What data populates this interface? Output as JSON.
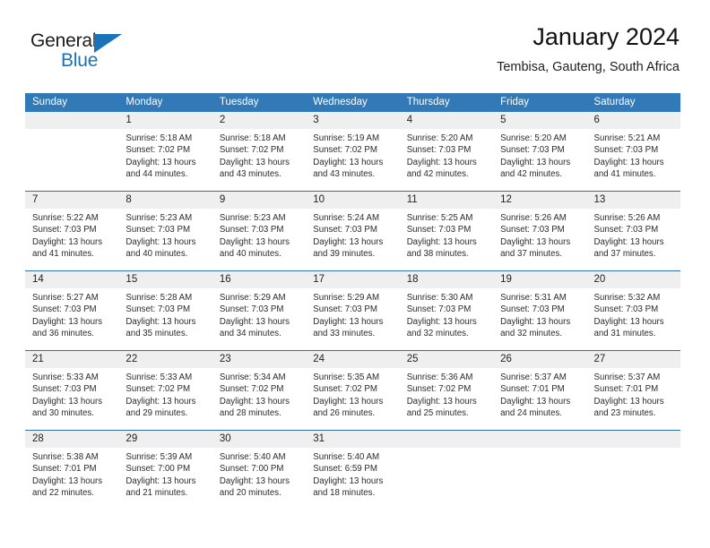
{
  "brand": {
    "word1": "General",
    "word2": "Blue",
    "logo_icon": "triangle-flag-icon",
    "accent_color": "#1a72b8"
  },
  "header": {
    "title": "January 2024",
    "location": "Tembisa, Gauteng, South Africa"
  },
  "calendar": {
    "header_bg": "#3279b7",
    "daynum_bg": "#efefef",
    "weekdays": [
      "Sunday",
      "Monday",
      "Tuesday",
      "Wednesday",
      "Thursday",
      "Friday",
      "Saturday"
    ],
    "weeks": [
      [
        {
          "day": "",
          "sunrise": "",
          "sunset": "",
          "daylight1": "",
          "daylight2": ""
        },
        {
          "day": "1",
          "sunrise": "Sunrise: 5:18 AM",
          "sunset": "Sunset: 7:02 PM",
          "daylight1": "Daylight: 13 hours",
          "daylight2": "and 44 minutes."
        },
        {
          "day": "2",
          "sunrise": "Sunrise: 5:18 AM",
          "sunset": "Sunset: 7:02 PM",
          "daylight1": "Daylight: 13 hours",
          "daylight2": "and 43 minutes."
        },
        {
          "day": "3",
          "sunrise": "Sunrise: 5:19 AM",
          "sunset": "Sunset: 7:02 PM",
          "daylight1": "Daylight: 13 hours",
          "daylight2": "and 43 minutes."
        },
        {
          "day": "4",
          "sunrise": "Sunrise: 5:20 AM",
          "sunset": "Sunset: 7:03 PM",
          "daylight1": "Daylight: 13 hours",
          "daylight2": "and 42 minutes."
        },
        {
          "day": "5",
          "sunrise": "Sunrise: 5:20 AM",
          "sunset": "Sunset: 7:03 PM",
          "daylight1": "Daylight: 13 hours",
          "daylight2": "and 42 minutes."
        },
        {
          "day": "6",
          "sunrise": "Sunrise: 5:21 AM",
          "sunset": "Sunset: 7:03 PM",
          "daylight1": "Daylight: 13 hours",
          "daylight2": "and 41 minutes."
        }
      ],
      [
        {
          "day": "7",
          "sunrise": "Sunrise: 5:22 AM",
          "sunset": "Sunset: 7:03 PM",
          "daylight1": "Daylight: 13 hours",
          "daylight2": "and 41 minutes."
        },
        {
          "day": "8",
          "sunrise": "Sunrise: 5:23 AM",
          "sunset": "Sunset: 7:03 PM",
          "daylight1": "Daylight: 13 hours",
          "daylight2": "and 40 minutes."
        },
        {
          "day": "9",
          "sunrise": "Sunrise: 5:23 AM",
          "sunset": "Sunset: 7:03 PM",
          "daylight1": "Daylight: 13 hours",
          "daylight2": "and 40 minutes."
        },
        {
          "day": "10",
          "sunrise": "Sunrise: 5:24 AM",
          "sunset": "Sunset: 7:03 PM",
          "daylight1": "Daylight: 13 hours",
          "daylight2": "and 39 minutes."
        },
        {
          "day": "11",
          "sunrise": "Sunrise: 5:25 AM",
          "sunset": "Sunset: 7:03 PM",
          "daylight1": "Daylight: 13 hours",
          "daylight2": "and 38 minutes."
        },
        {
          "day": "12",
          "sunrise": "Sunrise: 5:26 AM",
          "sunset": "Sunset: 7:03 PM",
          "daylight1": "Daylight: 13 hours",
          "daylight2": "and 37 minutes."
        },
        {
          "day": "13",
          "sunrise": "Sunrise: 5:26 AM",
          "sunset": "Sunset: 7:03 PM",
          "daylight1": "Daylight: 13 hours",
          "daylight2": "and 37 minutes."
        }
      ],
      [
        {
          "day": "14",
          "sunrise": "Sunrise: 5:27 AM",
          "sunset": "Sunset: 7:03 PM",
          "daylight1": "Daylight: 13 hours",
          "daylight2": "and 36 minutes."
        },
        {
          "day": "15",
          "sunrise": "Sunrise: 5:28 AM",
          "sunset": "Sunset: 7:03 PM",
          "daylight1": "Daylight: 13 hours",
          "daylight2": "and 35 minutes."
        },
        {
          "day": "16",
          "sunrise": "Sunrise: 5:29 AM",
          "sunset": "Sunset: 7:03 PM",
          "daylight1": "Daylight: 13 hours",
          "daylight2": "and 34 minutes."
        },
        {
          "day": "17",
          "sunrise": "Sunrise: 5:29 AM",
          "sunset": "Sunset: 7:03 PM",
          "daylight1": "Daylight: 13 hours",
          "daylight2": "and 33 minutes."
        },
        {
          "day": "18",
          "sunrise": "Sunrise: 5:30 AM",
          "sunset": "Sunset: 7:03 PM",
          "daylight1": "Daylight: 13 hours",
          "daylight2": "and 32 minutes."
        },
        {
          "day": "19",
          "sunrise": "Sunrise: 5:31 AM",
          "sunset": "Sunset: 7:03 PM",
          "daylight1": "Daylight: 13 hours",
          "daylight2": "and 32 minutes."
        },
        {
          "day": "20",
          "sunrise": "Sunrise: 5:32 AM",
          "sunset": "Sunset: 7:03 PM",
          "daylight1": "Daylight: 13 hours",
          "daylight2": "and 31 minutes."
        }
      ],
      [
        {
          "day": "21",
          "sunrise": "Sunrise: 5:33 AM",
          "sunset": "Sunset: 7:03 PM",
          "daylight1": "Daylight: 13 hours",
          "daylight2": "and 30 minutes."
        },
        {
          "day": "22",
          "sunrise": "Sunrise: 5:33 AM",
          "sunset": "Sunset: 7:02 PM",
          "daylight1": "Daylight: 13 hours",
          "daylight2": "and 29 minutes."
        },
        {
          "day": "23",
          "sunrise": "Sunrise: 5:34 AM",
          "sunset": "Sunset: 7:02 PM",
          "daylight1": "Daylight: 13 hours",
          "daylight2": "and 28 minutes."
        },
        {
          "day": "24",
          "sunrise": "Sunrise: 5:35 AM",
          "sunset": "Sunset: 7:02 PM",
          "daylight1": "Daylight: 13 hours",
          "daylight2": "and 26 minutes."
        },
        {
          "day": "25",
          "sunrise": "Sunrise: 5:36 AM",
          "sunset": "Sunset: 7:02 PM",
          "daylight1": "Daylight: 13 hours",
          "daylight2": "and 25 minutes."
        },
        {
          "day": "26",
          "sunrise": "Sunrise: 5:37 AM",
          "sunset": "Sunset: 7:01 PM",
          "daylight1": "Daylight: 13 hours",
          "daylight2": "and 24 minutes."
        },
        {
          "day": "27",
          "sunrise": "Sunrise: 5:37 AM",
          "sunset": "Sunset: 7:01 PM",
          "daylight1": "Daylight: 13 hours",
          "daylight2": "and 23 minutes."
        }
      ],
      [
        {
          "day": "28",
          "sunrise": "Sunrise: 5:38 AM",
          "sunset": "Sunset: 7:01 PM",
          "daylight1": "Daylight: 13 hours",
          "daylight2": "and 22 minutes."
        },
        {
          "day": "29",
          "sunrise": "Sunrise: 5:39 AM",
          "sunset": "Sunset: 7:00 PM",
          "daylight1": "Daylight: 13 hours",
          "daylight2": "and 21 minutes."
        },
        {
          "day": "30",
          "sunrise": "Sunrise: 5:40 AM",
          "sunset": "Sunset: 7:00 PM",
          "daylight1": "Daylight: 13 hours",
          "daylight2": "and 20 minutes."
        },
        {
          "day": "31",
          "sunrise": "Sunrise: 5:40 AM",
          "sunset": "Sunset: 6:59 PM",
          "daylight1": "Daylight: 13 hours",
          "daylight2": "and 18 minutes."
        },
        {
          "day": "",
          "sunrise": "",
          "sunset": "",
          "daylight1": "",
          "daylight2": ""
        },
        {
          "day": "",
          "sunrise": "",
          "sunset": "",
          "daylight1": "",
          "daylight2": ""
        },
        {
          "day": "",
          "sunrise": "",
          "sunset": "",
          "daylight1": "",
          "daylight2": ""
        }
      ]
    ]
  }
}
